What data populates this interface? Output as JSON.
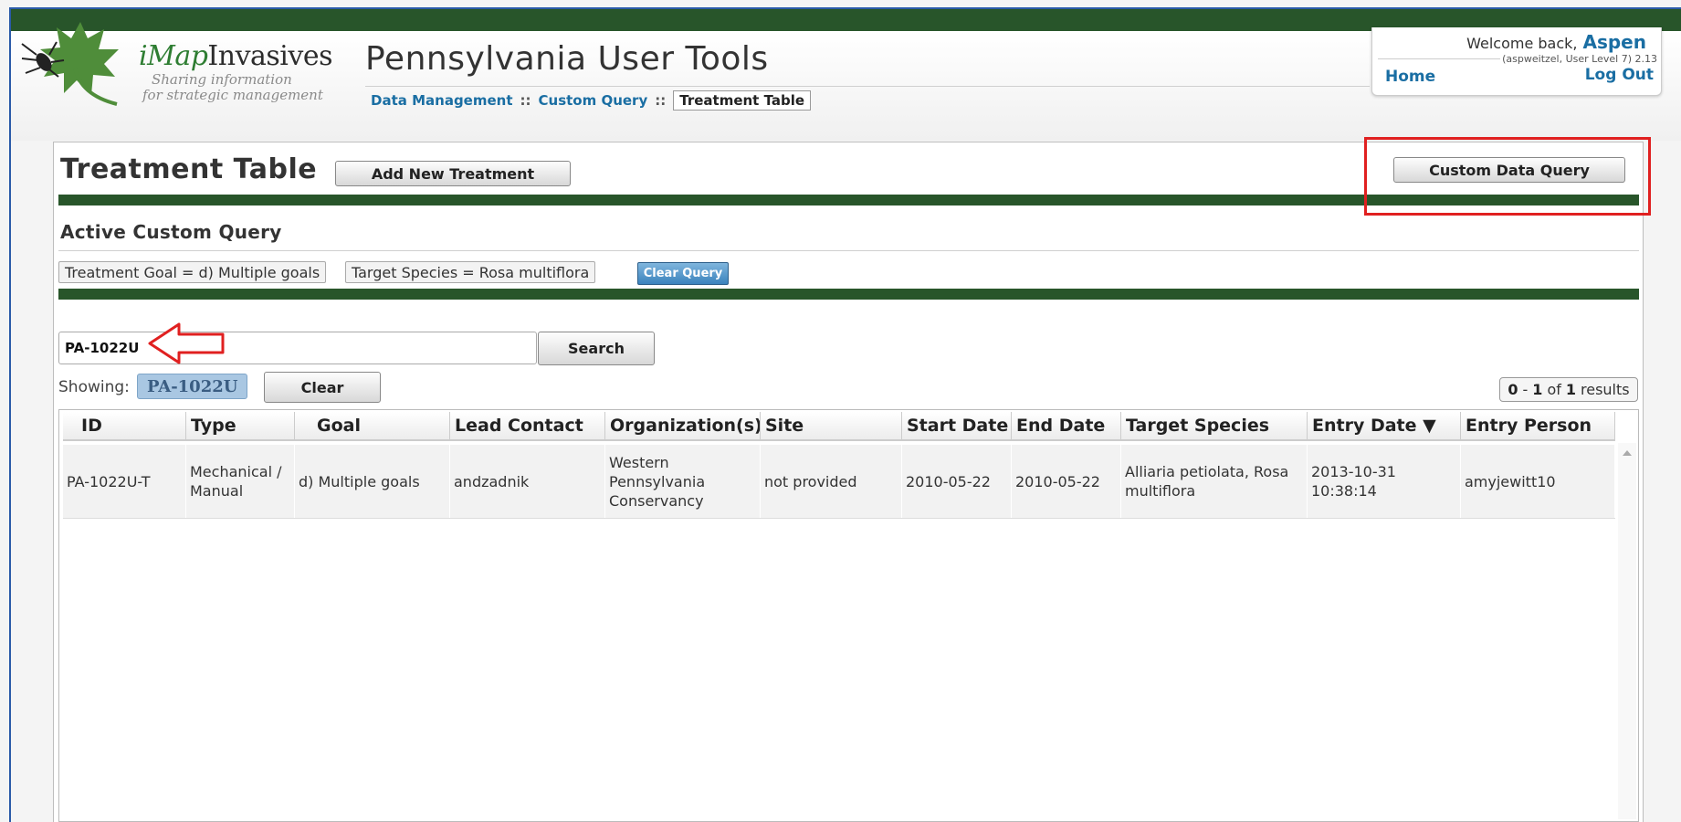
{
  "brand": {
    "name_prefix": "iMap",
    "name_suffix": "Invasives",
    "tagline_line1": "Sharing information",
    "tagline_line2": "for strategic management",
    "logo_icon": "leaf-beetle-logo"
  },
  "header": {
    "app_title": "Pennsylvania User Tools",
    "breadcrumb": {
      "item1": "Data Management",
      "sep": "::",
      "item2": "Custom Query",
      "current": "Treatment Table"
    }
  },
  "user": {
    "welcome_text": "Welcome back,",
    "username": "Aspen",
    "detail": "(aspweitzel, User Level 7) 2.13",
    "home_label": "Home",
    "logout_label": "Log Out"
  },
  "page": {
    "title": "Treatment Table",
    "add_button": "Add New Treatment",
    "custom_query_button": "Custom Data Query"
  },
  "active_query": {
    "title": "Active Custom Query",
    "filters": [
      "Treatment Goal = d) Multiple goals",
      "Target Species = Rosa multiflora"
    ],
    "clear_label": "Clear Query"
  },
  "search": {
    "value": "PA-1022U",
    "button_label": "Search",
    "showing_label": "Showing:",
    "showing_value": "PA-1022U",
    "clear_label": "Clear"
  },
  "results": {
    "start": "0",
    "dash": "-",
    "end": "1",
    "of": "of",
    "total": "1",
    "word": "results"
  },
  "table": {
    "columns": [
      "ID",
      "Type",
      "Goal",
      "Lead Contact",
      "Organization(s)",
      "Site",
      "Start Date",
      "End Date",
      "Target Species",
      "Entry Date ▼",
      "Entry Person"
    ],
    "rows": [
      {
        "id": "PA-1022U-T",
        "type": "Mechanical / Manual",
        "goal": "d) Multiple goals",
        "lead_contact": "andzadnik",
        "organization": "Western Pennsylvania Conservancy",
        "site": "not provided",
        "start_date": "2010-05-22",
        "end_date": "2010-05-22",
        "target_species": "Alliaria petiolata, Rosa multiflora",
        "entry_date": "2013-10-31 10:38:14",
        "entry_person": "amyjewitt10"
      }
    ]
  },
  "colors": {
    "dark_green": "#28552a",
    "link_blue": "#1a6ea3",
    "highlight_red": "#e02020"
  }
}
